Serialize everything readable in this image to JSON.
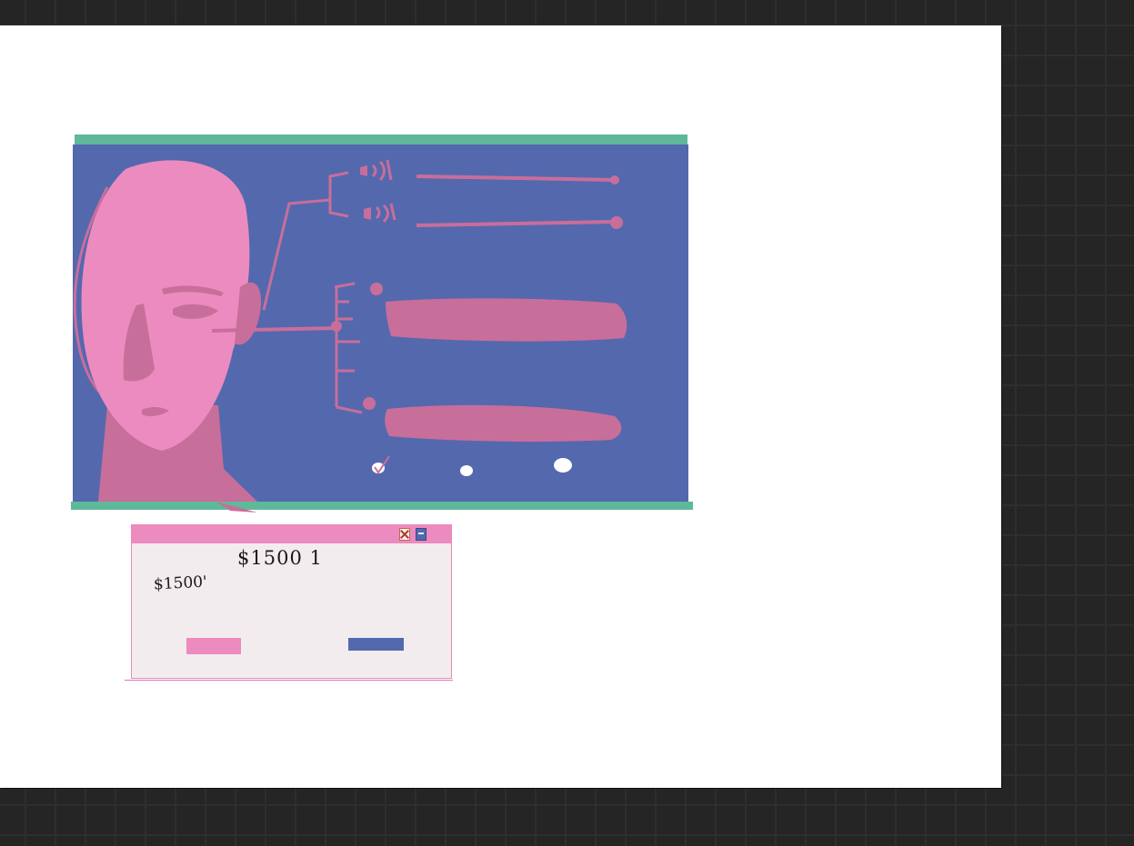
{
  "colors": {
    "board_background": "#252525",
    "canvas": "#ffffff",
    "panel_blue": "#5468ae",
    "accent_green": "#5fb89a",
    "skin_pink": "#ec8bbf",
    "shadow_rose": "#c86e9a",
    "dialog_background": "#f2ecef"
  },
  "dialog": {
    "amount_large": "$1500 1",
    "amount_small": "$1500'"
  },
  "icons": {
    "close": "close-icon",
    "minimize": "minimize-icon",
    "speaker_top": "speaker-icon",
    "speaker_bottom": "speaker-icon",
    "carousel_dots": [
      "dot-checked",
      "dot",
      "dot"
    ]
  }
}
